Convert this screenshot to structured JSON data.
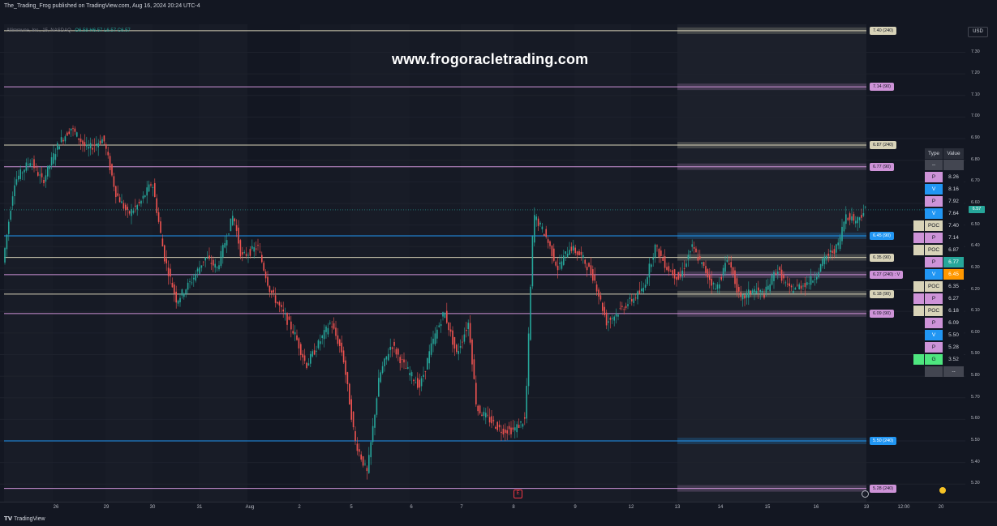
{
  "header": {
    "published": "The_Trading_Frog published on TradingView.com, Aug 16, 2024 20:24 UTC-4"
  },
  "symbol": {
    "name": "Allimmune, Inc., 15, NASDAQ",
    "ohlc": "O6.58 H6.57 L6.57 C6.57"
  },
  "watermark": "www.frogoracletrading.com",
  "currency": "USD",
  "current_price": "6.57",
  "y_axis": [
    "7.30",
    "7.20",
    "7.10",
    "7.00",
    "6.90",
    "6.80",
    "6.70",
    "6.60",
    "6.50",
    "6.40",
    "6.30",
    "6.20",
    "6.10",
    "6.00",
    "5.90",
    "5.80",
    "5.70",
    "5.60",
    "5.50",
    "5.40",
    "5.30"
  ],
  "x_axis": [
    "26",
    "29",
    "30",
    "31",
    "Aug",
    "2",
    "5",
    "6",
    "7",
    "8",
    "9",
    "12",
    "13",
    "14",
    "15",
    "16",
    "19",
    "12:00",
    "20"
  ],
  "levels": [
    {
      "price": 7.4,
      "label": "7.40 (240)",
      "type": "POC"
    },
    {
      "price": 7.14,
      "label": "7.14 (90)",
      "type": "P"
    },
    {
      "price": 6.87,
      "label": "6.87 (240)",
      "type": "POC"
    },
    {
      "price": 6.77,
      "label": "6.77 (90)",
      "type": "P"
    },
    {
      "price": 6.45,
      "label": "6.45 (90)",
      "type": "V"
    },
    {
      "price": 6.35,
      "label": "6.35 (90)",
      "type": "POC"
    },
    {
      "price": 6.27,
      "label": "6.27 (240) : V",
      "type": "P"
    },
    {
      "price": 6.18,
      "label": "6.18 (90)",
      "type": "POC"
    },
    {
      "price": 6.09,
      "label": "6.09 (90)",
      "type": "P"
    },
    {
      "price": 5.5,
      "label": "5.50 (240)",
      "type": "V"
    },
    {
      "price": 5.28,
      "label": "5.28 (240)",
      "type": "P"
    }
  ],
  "colors": {
    "P": "#ce93d8",
    "V": "#2196f3",
    "POC": "#d8d3b8",
    "G": "#4ee67f",
    "up": "#26a69a",
    "down": "#ef5350",
    "highlight_green": "#26a69a",
    "highlight_orange": "#ff9800"
  },
  "table": {
    "headers": {
      "type": "Type",
      "value": "Value"
    },
    "dash": "--",
    "rows": [
      {
        "type": "P",
        "value": "8.26"
      },
      {
        "type": "V",
        "value": "8.16"
      },
      {
        "type": "P",
        "value": "7.92"
      },
      {
        "type": "V",
        "value": "7.64"
      },
      {
        "type": "POC",
        "value": "7.40",
        "marker": true
      },
      {
        "type": "P",
        "value": "7.14",
        "marker": true
      },
      {
        "type": "POC",
        "value": "6.87",
        "marker": true
      },
      {
        "type": "P",
        "value": "6.77",
        "hl": "green"
      },
      {
        "type": "V",
        "value": "6.45",
        "hl": "orange"
      },
      {
        "type": "POC",
        "value": "6.35",
        "marker": true
      },
      {
        "type": "P",
        "value": "6.27",
        "marker": true
      },
      {
        "type": "POC",
        "value": "6.18",
        "marker": true
      },
      {
        "type": "P",
        "value": "6.09"
      },
      {
        "type": "V",
        "value": "5.50"
      },
      {
        "type": "P",
        "value": "5.28"
      },
      {
        "type": "G",
        "value": "3.52",
        "marker": true
      }
    ]
  },
  "earnings_badge": "E",
  "footer": {
    "brand": "TradingView"
  }
}
